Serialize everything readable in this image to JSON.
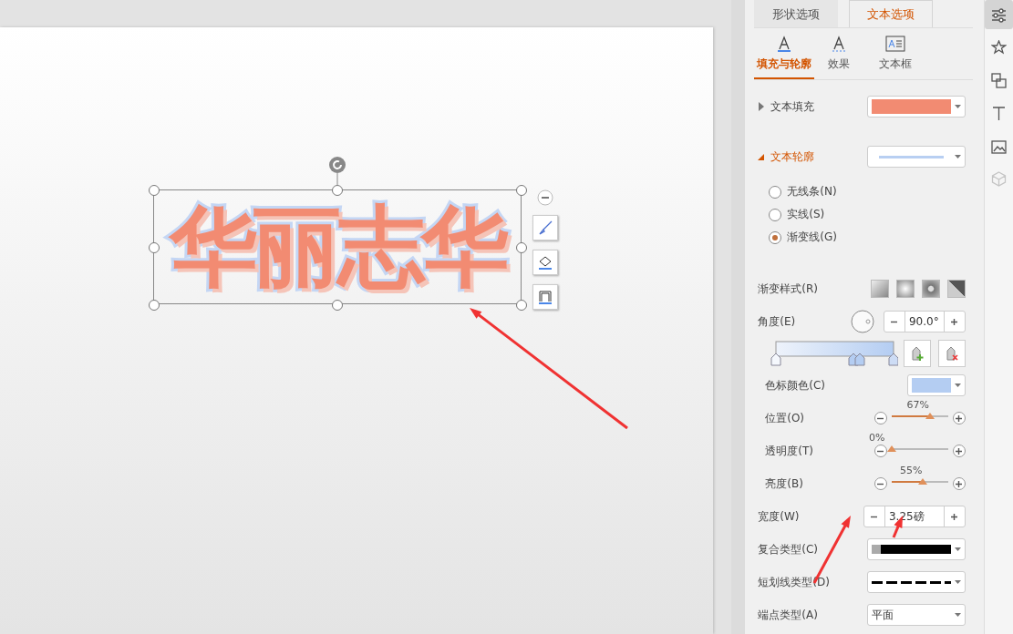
{
  "canvas": {
    "text_art": "华丽志华"
  },
  "panel": {
    "tabs": [
      {
        "label": "形状选项",
        "selected": false
      },
      {
        "label": "文本选项",
        "selected": true
      }
    ],
    "subtabs": [
      {
        "label": "填充与轮廓",
        "selected": true,
        "kind": "fill"
      },
      {
        "label": "效果",
        "selected": false,
        "kind": "effect"
      },
      {
        "label": "文本框",
        "selected": false,
        "kind": "box"
      }
    ],
    "text_fill": {
      "label": "文本填充",
      "expanded": false,
      "color": "#f28b72"
    },
    "text_outline": {
      "label": "文本轮廓",
      "expanded": true,
      "color": "#b8cff2"
    },
    "line_options": [
      {
        "label": "无线条(N)",
        "selected": false
      },
      {
        "label": "实线(S)",
        "selected": false
      },
      {
        "label": "渐变线(G)",
        "selected": true
      }
    ],
    "gradient_style": {
      "label": "渐变样式(R)"
    },
    "angle": {
      "label": "角度(E)",
      "value": "90.0°"
    },
    "stop_color": {
      "label": "色标颜色(C)",
      "color": "#b4cdf2"
    },
    "sliders": [
      {
        "label": "位置(O)",
        "level": 0.67,
        "reading": "67%"
      },
      {
        "label": "透明度(T)",
        "level": 0,
        "reading": "0%"
      },
      {
        "label": "亮度(B)",
        "level": 0.55,
        "reading": "55%"
      }
    ],
    "width": {
      "label": "宽度(W)",
      "value": "3.25磅"
    },
    "line_rows": [
      {
        "label": "复合类型(C)",
        "kind": "compound"
      },
      {
        "label": "短划线类型(D)",
        "kind": "dash"
      },
      {
        "label": "端点类型(A)",
        "kind": "text",
        "value": "平面"
      }
    ]
  },
  "rail": [
    {
      "selected": true,
      "disabled": false,
      "kind": "sliders"
    },
    {
      "selected": false,
      "disabled": false,
      "kind": "star"
    },
    {
      "selected": false,
      "disabled": false,
      "kind": "swap"
    },
    {
      "selected": false,
      "disabled": false,
      "kind": "text"
    },
    {
      "selected": false,
      "disabled": false,
      "kind": "image"
    },
    {
      "selected": false,
      "disabled": true,
      "kind": "cube"
    }
  ]
}
